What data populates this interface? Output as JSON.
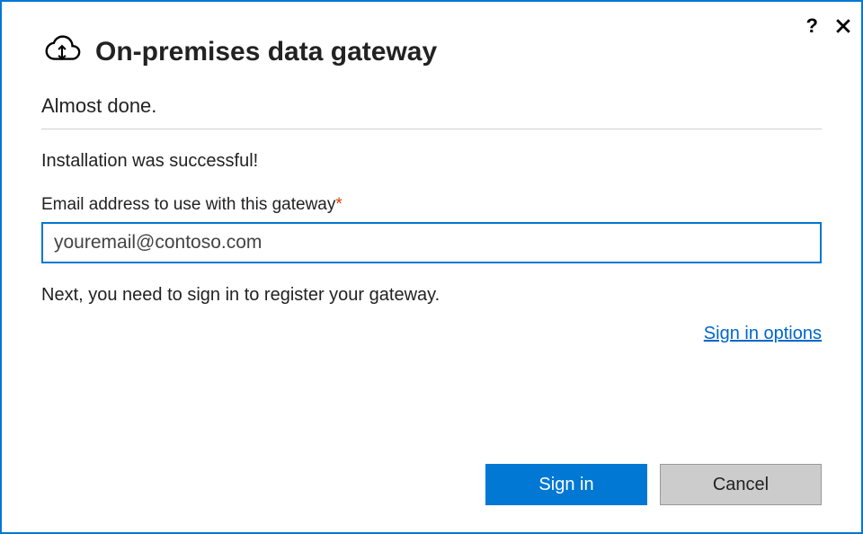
{
  "window": {
    "title": "On-premises data gateway",
    "subtitle": "Almost done."
  },
  "body": {
    "success_message": "Installation was successful!",
    "email_label": "Email address to use with this gateway",
    "required_star": "*",
    "email_value": "youremail@contoso.com",
    "next_message": "Next, you need to sign in to register your gateway.",
    "signin_options_label": "Sign in options"
  },
  "footer": {
    "signin_label": "Sign in",
    "cancel_label": "Cancel"
  },
  "icons": {
    "help": "?",
    "close": "close-icon",
    "cloud": "cloud-sync-icon"
  }
}
